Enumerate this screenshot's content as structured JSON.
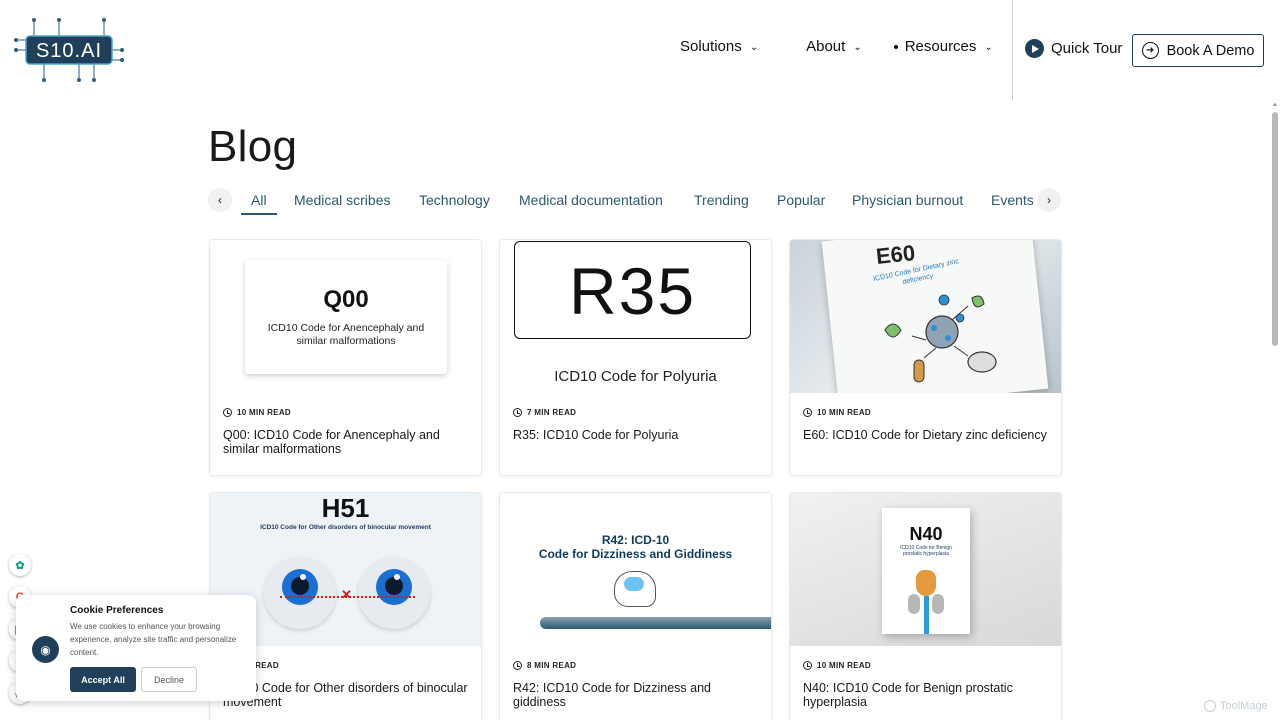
{
  "brand": {
    "logo_text": "S10.AI"
  },
  "nav": {
    "solutions": "Solutions",
    "about": "About",
    "resources": "Resources",
    "quick_tour": "Quick Tour",
    "book_demo": "Book A Demo"
  },
  "blog": {
    "title": "Blog",
    "categories": [
      "All",
      "Medical scribes",
      "Technology",
      "Medical documentation",
      "Trending",
      "Popular",
      "Physician burnout",
      "Events"
    ],
    "active_category": "All"
  },
  "posts": [
    {
      "read_time": "10 MIN READ",
      "title": "Q00: ICD10 Code for Anencephaly and similar malformations",
      "image_code": "Q00",
      "image_caption": "ICD10 Code for Anencephaly and similar malformations"
    },
    {
      "read_time": "7 MIN READ",
      "title": "R35: ICD10 Code for Polyuria",
      "image_code": "R35",
      "image_caption": "ICD10 Code for Polyuria"
    },
    {
      "read_time": "10 MIN READ",
      "title": "E60: ICD10 Code for Dietary zinc deficiency",
      "image_code": "E60",
      "image_caption": "ICD10 Code for Dietary zinc deficiency"
    },
    {
      "read_time": "MIN READ",
      "title": "ICD10 Code for Other disorders of binocular movement",
      "image_code": "H51",
      "image_caption": "ICD10 Code for Other disorders of binocular movement"
    },
    {
      "read_time": "8 MIN READ",
      "title": "R42: ICD10 Code for Dizziness and giddiness",
      "image_code": "R42: ICD-10",
      "image_caption": "Code for Dizziness and Giddiness"
    },
    {
      "read_time": "10 MIN READ",
      "title": "N40: ICD10 Code for Benign prostatic hyperplasia",
      "image_code": "N40",
      "image_caption": "ICD10 Code for Benign prostatic hyperplasia"
    }
  ],
  "cookie": {
    "title": "Cookie Preferences",
    "text": "We use cookies to enhance your browsing experience, analyze site traffic and personalize content.",
    "accept": "Accept All",
    "decline": "Decline"
  },
  "watermark": "ToolMage",
  "colors": {
    "brand": "#1f3f5b",
    "category": "#2a5a6e"
  },
  "icons": [
    "play-icon",
    "arrow-right-icon",
    "chevron-down-icon",
    "chevron-left-icon",
    "chevron-right-icon",
    "clock-icon",
    "cookie-icon"
  ]
}
